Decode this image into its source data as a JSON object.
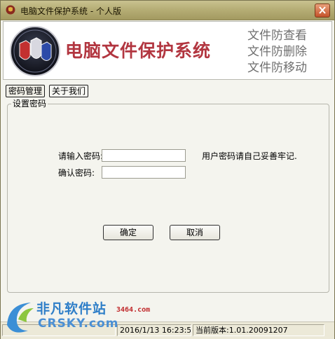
{
  "window": {
    "title": "电脑文件保护系统 - 个人版"
  },
  "banner": {
    "brand": "电脑文件保护系统",
    "slogans": [
      "文件防查看",
      "文件防删除",
      "文件防移动"
    ]
  },
  "tabs": [
    {
      "label": "密码管理",
      "active": true
    },
    {
      "label": "关于我们",
      "active": false
    }
  ],
  "password_group": {
    "title": "设置密码",
    "password_label": "请输入密码:",
    "password_value": "",
    "confirm_label": "确认密码:",
    "confirm_value": "",
    "hint": "用户密码请自己妥善牢记.",
    "ok_label": "确定",
    "cancel_label": "取消"
  },
  "status": {
    "datetime": "2016/1/13 16:23:5",
    "version": "当前版本:1.01.20091207"
  },
  "watermark": {
    "cn": "非凡软件站",
    "en": "CRSKY.com",
    "site": "3464.com"
  },
  "colors": {
    "titlebar": "#b6ae76",
    "brand": "#b23640",
    "slogan": "#6f6f6f",
    "window_bg": "#f4f4ee"
  }
}
